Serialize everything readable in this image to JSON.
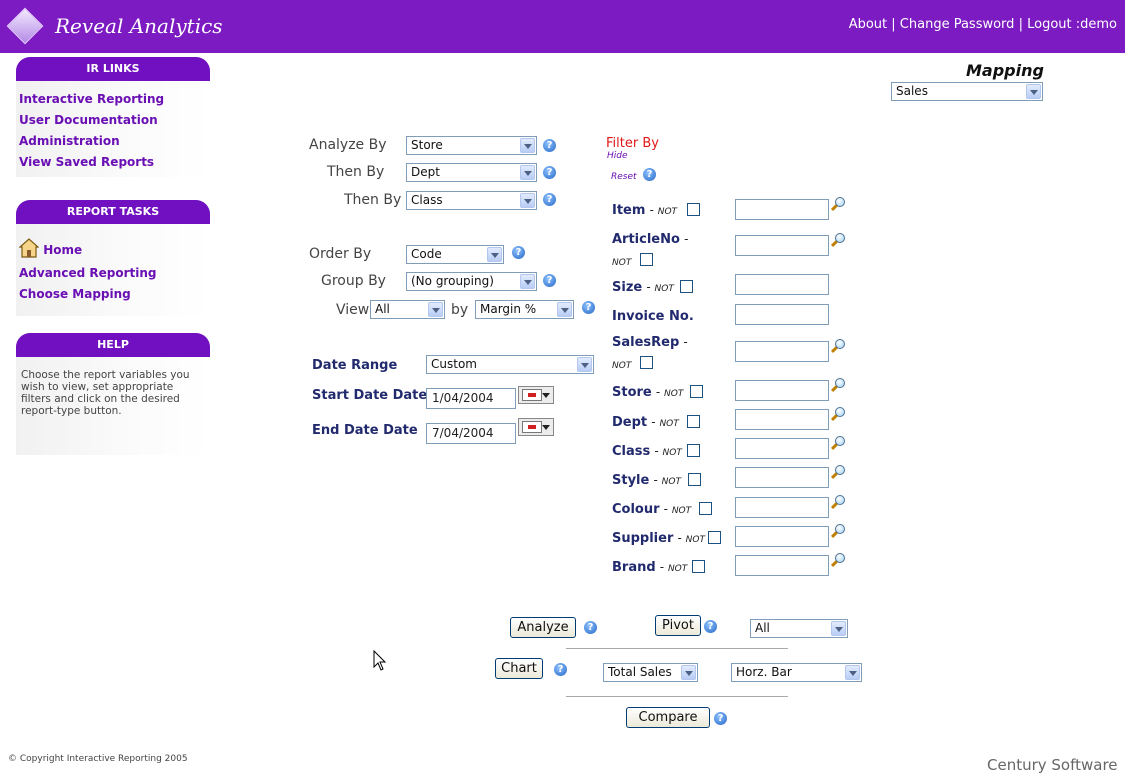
{
  "header": {
    "app_title": "Reveal Analytics",
    "links": [
      "About",
      "Change Password",
      "Logout :demo"
    ],
    "separator": "|"
  },
  "sidebar": {
    "ir_links": {
      "title": "IR LINKS",
      "items": [
        "Interactive Reporting",
        "User Documentation",
        "Administration",
        "View Saved Reports"
      ]
    },
    "report_tasks": {
      "title": "REPORT TASKS",
      "home": "Home",
      "items": [
        "Advanced Reporting",
        "Choose Mapping"
      ]
    },
    "help": {
      "title": "HELP",
      "text": "Choose the report variables you wish to view, set appropriate filters and click on the desired report-type button."
    }
  },
  "mapping": {
    "title": "Mapping",
    "value": "Sales"
  },
  "analyze": {
    "analyze_by_label": "Analyze By",
    "analyze_by_value": "Store",
    "then_by_1_label": "Then By",
    "then_by_1_value": "Dept",
    "then_by_2_label": "Then By",
    "then_by_2_value": "Class"
  },
  "order": {
    "order_by_label": "Order By",
    "order_by_value": "Code",
    "group_by_label": "Group By",
    "group_by_value": "(No grouping)",
    "view_label": "View",
    "view_value": "All",
    "by_label": "by",
    "by_value": "Margin %"
  },
  "dates": {
    "range_label": "Date Range",
    "range_value": "Custom",
    "start_label": "Start Date Date",
    "start_value": "1/04/2004",
    "end_label": "End Date Date",
    "end_value": "7/04/2004"
  },
  "filter": {
    "title": "Filter By",
    "hide": "Hide",
    "reset": "Reset",
    "not_label": "NOT",
    "fields": [
      {
        "label": "Item",
        "value": ""
      },
      {
        "label": "ArticleNo",
        "value": ""
      },
      {
        "label": "Size",
        "value": ""
      },
      {
        "label": "Invoice No.",
        "value": ""
      },
      {
        "label": "SalesRep",
        "value": ""
      },
      {
        "label": "Store",
        "value": ""
      },
      {
        "label": "Dept",
        "value": ""
      },
      {
        "label": "Class",
        "value": ""
      },
      {
        "label": "Style",
        "value": ""
      },
      {
        "label": "Colour",
        "value": ""
      },
      {
        "label": "Supplier",
        "value": ""
      },
      {
        "label": "Brand",
        "value": ""
      }
    ]
  },
  "actions": {
    "analyze": "Analyze",
    "pivot": "Pivot",
    "pivot_select": "All",
    "chart": "Chart",
    "chart_measure": "Total Sales",
    "chart_type": "Horz. Bar",
    "compare": "Compare"
  },
  "footer": {
    "copyright": "© Copyright Interactive Reporting 2005",
    "brand": "Century Software"
  },
  "icons": {
    "help": "question-circle-icon",
    "lookup": "magnifier-icon",
    "calendar": "calendar-icon",
    "home": "house-icon",
    "logo": "diamond-icon"
  },
  "colors": {
    "brand_purple": "#7c1bc2",
    "link_purple": "#6a0fb4",
    "label_navy": "#222a6e",
    "filter_red": "#e01818"
  }
}
